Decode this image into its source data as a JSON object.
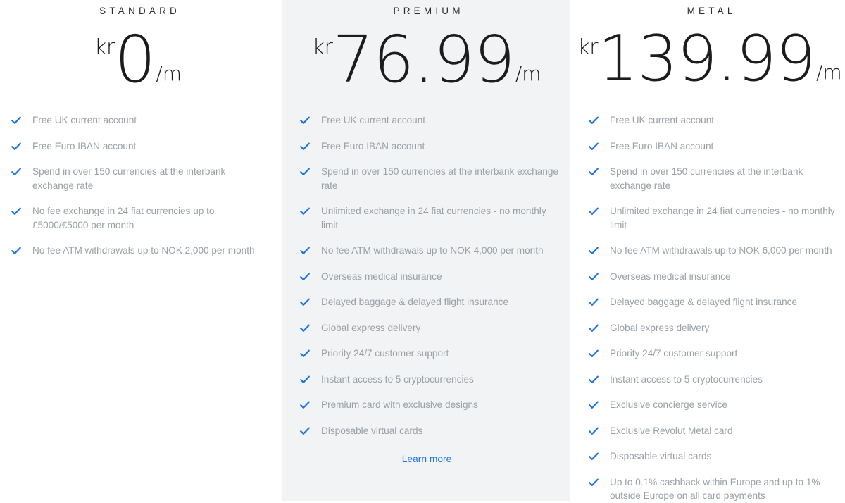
{
  "accent_blue": "#1a73e8",
  "feature_text_color": "#9aa0a6",
  "premium_bg": "#f1f3f4",
  "plans": [
    {
      "title": "STANDARD",
      "currency": "kr",
      "amount": "0",
      "per": "/m",
      "features": [
        "Free UK current account",
        "Free Euro IBAN account",
        "Spend in over 150 currencies at the interbank exchange rate",
        "No fee exchange in 24 fiat currencies up to £5000/€5000 per month",
        "No fee ATM withdrawals up to NOK 2,000 per month"
      ],
      "learn_more": ""
    },
    {
      "title": "PREMIUM",
      "currency": "kr",
      "amount": "76.99",
      "per": "/m",
      "features": [
        "Free UK current account",
        "Free Euro IBAN account",
        "Spend in over 150 currencies at the interbank exchange rate",
        "Unlimited exchange in 24 fiat currencies - no monthly limit",
        "No fee ATM withdrawals up to NOK 4,000 per month",
        "Overseas medical insurance",
        "Delayed baggage & delayed flight insurance",
        "Global express delivery",
        "Priority 24/7 customer support",
        "Instant access to 5 cryptocurrencies",
        "Premium card with exclusive designs",
        "Disposable virtual cards"
      ],
      "learn_more": "Learn more"
    },
    {
      "title": "METAL",
      "currency": "kr",
      "amount": "139.99",
      "per": "/m",
      "features": [
        "Free UK current account",
        "Free Euro IBAN account",
        "Spend in over 150 currencies at the interbank exchange rate",
        "Unlimited exchange in 24 fiat currencies - no monthly limit",
        "No fee ATM withdrawals up to NOK 6,000 per month",
        "Overseas medical insurance",
        "Delayed baggage & delayed flight insurance",
        "Global express delivery",
        "Priority 24/7 customer support",
        "Instant access to 5 cryptocurrencies",
        "Exclusive concierge service",
        "Exclusive Revolut Metal card",
        "Disposable virtual cards",
        "Up to 0.1% cashback within Europe and up to 1% outside Europe on all card payments"
      ],
      "learn_more": ""
    }
  ]
}
